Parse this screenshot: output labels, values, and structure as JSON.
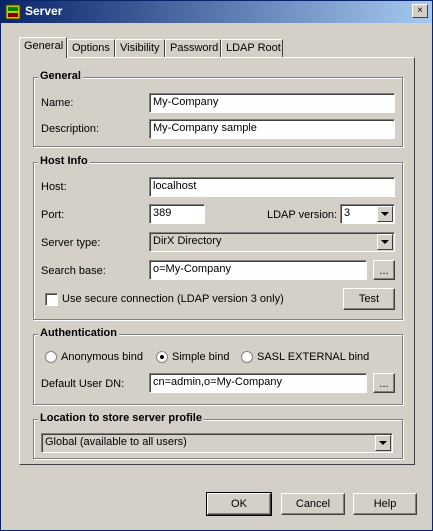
{
  "window": {
    "title": "Server",
    "close_glyph": "×"
  },
  "tabs": [
    "General",
    "Options",
    "Visibility",
    "Password",
    "LDAP Root"
  ],
  "general": {
    "title": "General",
    "name_label": "Name:",
    "name_value": "My-Company",
    "description_label": "Description:",
    "description_value": "My-Company sample"
  },
  "host_info": {
    "title": "Host Info",
    "host_label": "Host:",
    "host_value": "localhost",
    "port_label": "Port:",
    "port_value": "389",
    "ldap_version_label": "LDAP version:",
    "ldap_version_value": "3",
    "server_type_label": "Server type:",
    "server_type_value": "DirX Directory",
    "search_base_label": "Search base:",
    "search_base_value": "o=My-Company",
    "browse_label": "...",
    "secure_label": "Use secure connection (LDAP version 3 only)",
    "secure_checked": false,
    "test_label": "Test"
  },
  "authentication": {
    "title": "Authentication",
    "anonymous_label": "Anonymous bind",
    "simple_label": "Simple bind",
    "sasl_label": "SASL EXTERNAL bind",
    "selected": "Simple bind",
    "user_dn_label": "Default User DN:",
    "user_dn_value": "cn=admin,o=My-Company",
    "browse_label": "..."
  },
  "location": {
    "title": "Location to store server profile",
    "value": "Global (available to all users)"
  },
  "buttons": {
    "ok": "OK",
    "cancel": "Cancel",
    "help": "Help"
  }
}
